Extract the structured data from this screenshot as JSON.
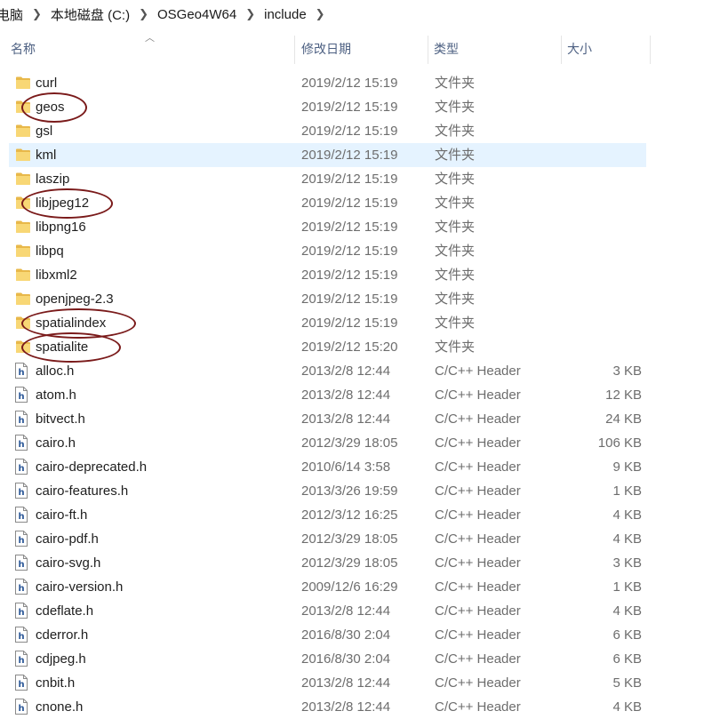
{
  "breadcrumb": [
    "电脑",
    "本地磁盘 (C:)",
    "OSGeo4W64",
    "include"
  ],
  "columns": {
    "name": "名称",
    "date": "修改日期",
    "type": "类型",
    "size": "大小"
  },
  "rows": [
    {
      "name": "curl",
      "date": "2019/2/12 15:19",
      "type": "文件夹",
      "size": "",
      "kind": "folder"
    },
    {
      "name": "geos",
      "date": "2019/2/12 15:19",
      "type": "文件夹",
      "size": "",
      "kind": "folder",
      "marked": true
    },
    {
      "name": "gsl",
      "date": "2019/2/12 15:19",
      "type": "文件夹",
      "size": "",
      "kind": "folder"
    },
    {
      "name": "kml",
      "date": "2019/2/12 15:19",
      "type": "文件夹",
      "size": "",
      "kind": "folder",
      "selected": true
    },
    {
      "name": "laszip",
      "date": "2019/2/12 15:19",
      "type": "文件夹",
      "size": "",
      "kind": "folder"
    },
    {
      "name": "libjpeg12",
      "date": "2019/2/12 15:19",
      "type": "文件夹",
      "size": "",
      "kind": "folder",
      "marked": true
    },
    {
      "name": "libpng16",
      "date": "2019/2/12 15:19",
      "type": "文件夹",
      "size": "",
      "kind": "folder"
    },
    {
      "name": "libpq",
      "date": "2019/2/12 15:19",
      "type": "文件夹",
      "size": "",
      "kind": "folder"
    },
    {
      "name": "libxml2",
      "date": "2019/2/12 15:19",
      "type": "文件夹",
      "size": "",
      "kind": "folder"
    },
    {
      "name": "openjpeg-2.3",
      "date": "2019/2/12 15:19",
      "type": "文件夹",
      "size": "",
      "kind": "folder"
    },
    {
      "name": "spatialindex",
      "date": "2019/2/12 15:19",
      "type": "文件夹",
      "size": "",
      "kind": "folder",
      "marked": true
    },
    {
      "name": "spatialite",
      "date": "2019/2/12 15:20",
      "type": "文件夹",
      "size": "",
      "kind": "folder",
      "marked": true
    },
    {
      "name": "alloc.h",
      "date": "2013/2/8 12:44",
      "type": "C/C++ Header",
      "size": "3 KB",
      "kind": "file"
    },
    {
      "name": "atom.h",
      "date": "2013/2/8 12:44",
      "type": "C/C++ Header",
      "size": "12 KB",
      "kind": "file"
    },
    {
      "name": "bitvect.h",
      "date": "2013/2/8 12:44",
      "type": "C/C++ Header",
      "size": "24 KB",
      "kind": "file"
    },
    {
      "name": "cairo.h",
      "date": "2012/3/29 18:05",
      "type": "C/C++ Header",
      "size": "106 KB",
      "kind": "file"
    },
    {
      "name": "cairo-deprecated.h",
      "date": "2010/6/14 3:58",
      "type": "C/C++ Header",
      "size": "9 KB",
      "kind": "file"
    },
    {
      "name": "cairo-features.h",
      "date": "2013/3/26 19:59",
      "type": "C/C++ Header",
      "size": "1 KB",
      "kind": "file"
    },
    {
      "name": "cairo-ft.h",
      "date": "2012/3/12 16:25",
      "type": "C/C++ Header",
      "size": "4 KB",
      "kind": "file"
    },
    {
      "name": "cairo-pdf.h",
      "date": "2012/3/29 18:05",
      "type": "C/C++ Header",
      "size": "4 KB",
      "kind": "file"
    },
    {
      "name": "cairo-svg.h",
      "date": "2012/3/29 18:05",
      "type": "C/C++ Header",
      "size": "3 KB",
      "kind": "file"
    },
    {
      "name": "cairo-version.h",
      "date": "2009/12/6 16:29",
      "type": "C/C++ Header",
      "size": "1 KB",
      "kind": "file"
    },
    {
      "name": "cdeflate.h",
      "date": "2013/2/8 12:44",
      "type": "C/C++ Header",
      "size": "4 KB",
      "kind": "file"
    },
    {
      "name": "cderror.h",
      "date": "2016/8/30 2:04",
      "type": "C/C++ Header",
      "size": "6 KB",
      "kind": "file"
    },
    {
      "name": "cdjpeg.h",
      "date": "2016/8/30 2:04",
      "type": "C/C++ Header",
      "size": "6 KB",
      "kind": "file"
    },
    {
      "name": "cnbit.h",
      "date": "2013/2/8 12:44",
      "type": "C/C++ Header",
      "size": "5 KB",
      "kind": "file"
    },
    {
      "name": "cnone.h",
      "date": "2013/2/8 12:44",
      "type": "C/C++ Header",
      "size": "4 KB",
      "kind": "file"
    }
  ],
  "colors": {
    "selected_row": "#e5f3ff",
    "header_text": "#4d6082",
    "annotation": "#7a1a1a",
    "folder": "#f8d775"
  },
  "icons": {
    "sort": "sort-ascending-icon",
    "folder": "folder-icon",
    "file": "header-file-icon",
    "separator": "chevron-right-icon"
  }
}
